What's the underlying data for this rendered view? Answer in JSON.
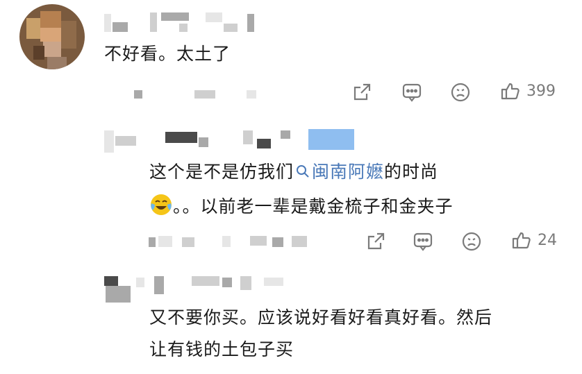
{
  "comments": [
    {
      "text": "不好看。太土了",
      "actions": {
        "like_count": "399"
      },
      "icons": [
        "share-icon",
        "comment-icon",
        "sad-face-icon",
        "thumbs-up-icon"
      ]
    },
    {
      "text_before_link": "这个是不是仿我们",
      "link_text": "闽南阿嬷",
      "text_after_link": "的时尚",
      "line2_text": "。。以前老一辈是戴金梳子和金夹子",
      "emoji": "crying-laughing-emoji",
      "actions": {
        "like_count": "24"
      },
      "icons": [
        "search-icon",
        "share-icon",
        "comment-icon",
        "sad-face-icon",
        "thumbs-up-icon"
      ]
    },
    {
      "line1": "又不要你买。应该说好看好看真好看。然后",
      "line2": "让有钱的土包子买"
    }
  ],
  "colors": {
    "link": "#4a79b8",
    "icon": "#7a7a7a",
    "emoji": "#f5c518"
  }
}
